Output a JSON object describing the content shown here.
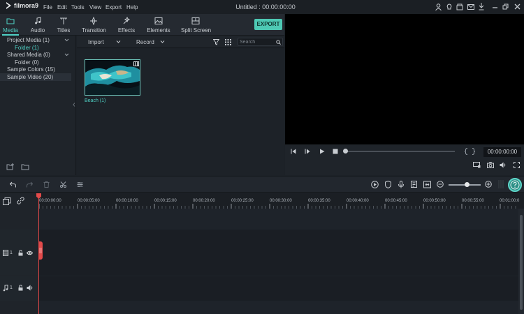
{
  "app": {
    "logo_text": "filmora9",
    "menu": [
      "File",
      "Edit",
      "Tools",
      "View",
      "Export",
      "Help"
    ],
    "window_title": "Untitled : 00:00:00:00"
  },
  "tabs": [
    {
      "label": "Media",
      "icon": "folder-icon",
      "active": true
    },
    {
      "label": "Audio",
      "icon": "music-note-icon",
      "active": false
    },
    {
      "label": "Titles",
      "icon": "text-icon",
      "active": false
    },
    {
      "label": "Transition",
      "icon": "transition-icon",
      "active": false
    },
    {
      "label": "Effects",
      "icon": "effects-icon",
      "active": false
    },
    {
      "label": "Elements",
      "icon": "image-icon",
      "active": false
    },
    {
      "label": "Split Screen",
      "icon": "split-screen-icon",
      "active": false
    }
  ],
  "export_label": "EXPORT",
  "library": [
    {
      "label": "Project Media (1)",
      "expandable": true
    },
    {
      "label": "Folder (1)",
      "sub": true,
      "accent": true
    },
    {
      "label": "Shared Media (0)",
      "expandable": true
    },
    {
      "label": "Folder (0)",
      "sub": true
    },
    {
      "label": "Sample Colors (15)"
    },
    {
      "label": "Sample Video (20)",
      "selected": true
    }
  ],
  "media_toolbar": {
    "import_label": "Import",
    "record_label": "Record",
    "search_placeholder": "Search"
  },
  "media_items": [
    {
      "label": "Beach (1)"
    }
  ],
  "preview": {
    "timecode": "00:00:00:00"
  },
  "timeline": {
    "ruler": [
      "00:00:00:00",
      "00:00:05:00",
      "00:00:10:00",
      "00:00:15:00",
      "00:00:20:00",
      "00:00:25:00",
      "00:00:30:00",
      "00:00:35:00",
      "00:00:40:00",
      "00:00:45:00",
      "00:00:50:00",
      "00:00:55:00",
      "00:01:00:0"
    ],
    "video_track_num": "1",
    "audio_track_num": "1",
    "zoom_level": 0.5
  },
  "colors": {
    "accent": "#4fd1c5",
    "playhead": "#e34a4a",
    "export_button": "#4ec9b4"
  }
}
